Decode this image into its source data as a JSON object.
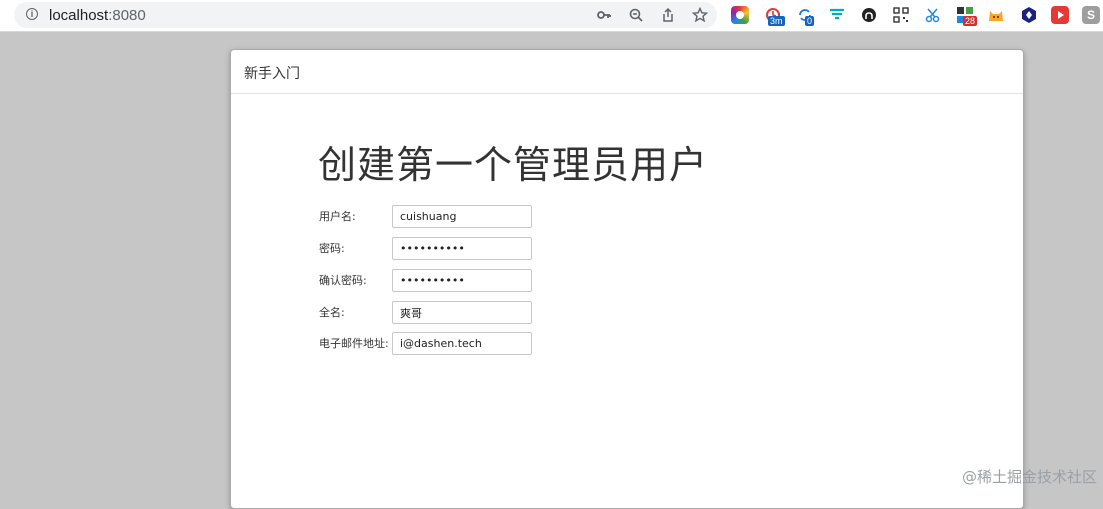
{
  "browser": {
    "url_host": "localhost",
    "url_port": ":8080",
    "badges": {
      "timer": "3m",
      "sync": "0",
      "ext_count": "28"
    }
  },
  "modal": {
    "title": "新手入门",
    "heading": "创建第一个管理员用户",
    "fields": [
      {
        "label": "用户名:",
        "value": "cuishuang",
        "type": "text"
      },
      {
        "label": "密码:",
        "value": "••••••••••",
        "type": "password"
      },
      {
        "label": "确认密码:",
        "value": "••••••••••",
        "type": "password"
      },
      {
        "label": "全名:",
        "value": "爽哥",
        "type": "text"
      },
      {
        "label": "电子邮件地址:",
        "value": "i@dashen.tech",
        "type": "text"
      }
    ]
  },
  "watermark": "@稀土掘金技术社区",
  "colors": {
    "page_background": "#c6c6c6",
    "modal_background": "#ffffff",
    "text": "#333333"
  }
}
